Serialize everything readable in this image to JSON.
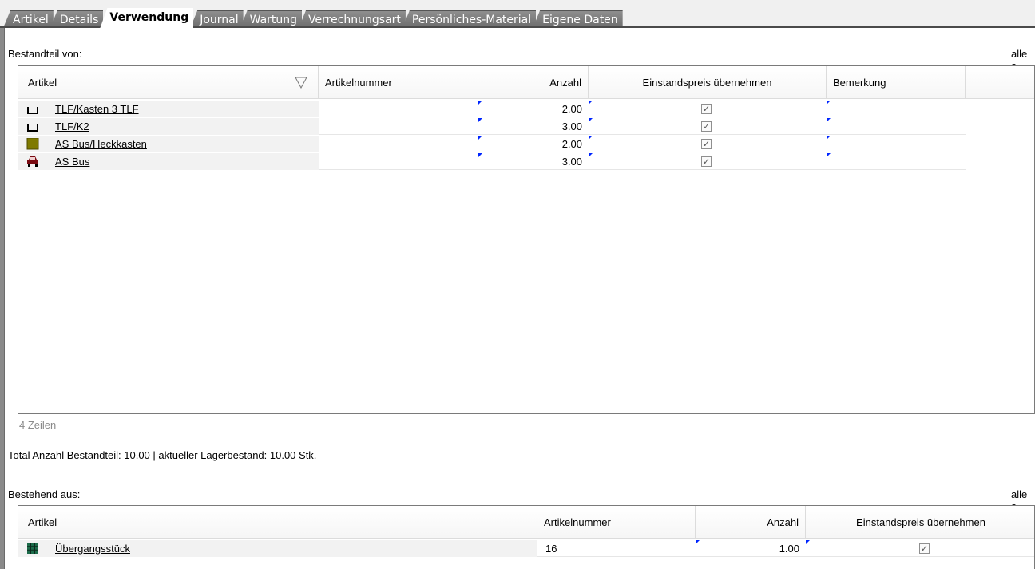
{
  "tabs": [
    {
      "label": "Artikel"
    },
    {
      "label": "Details"
    },
    {
      "label": "Verwendung",
      "active": true
    },
    {
      "label": "Journal"
    },
    {
      "label": "Wartung"
    },
    {
      "label": "Verrechnungsart"
    },
    {
      "label": "Persönliches-Material"
    },
    {
      "label": "Eigene Daten"
    }
  ],
  "top_section": {
    "label": "Bestandteil von:",
    "right_label": "alle a",
    "columns": [
      "Artikel",
      "Artikelnummer",
      "Anzahl",
      "Einstandspreis übernehmen",
      "Bemerkung"
    ],
    "rows": [
      {
        "icon": "bracket-icon",
        "artikel": "TLF/Kasten 3 TLF",
        "artikelnummer": "",
        "anzahl": "2.00",
        "einstandspreis": true,
        "bemerkung": ""
      },
      {
        "icon": "bracket-icon",
        "artikel": "TLF/K2",
        "artikelnummer": "",
        "anzahl": "3.00",
        "einstandspreis": true,
        "bemerkung": ""
      },
      {
        "icon": "olive-box-icon",
        "artikel": "AS Bus/Heckkasten",
        "artikelnummer": "",
        "anzahl": "2.00",
        "einstandspreis": true,
        "bemerkung": ""
      },
      {
        "icon": "car-icon",
        "artikel": "AS Bus",
        "artikelnummer": "",
        "anzahl": "3.00",
        "einstandspreis": true,
        "bemerkung": ""
      }
    ],
    "status": "4 Zeilen",
    "totals": "Total Anzahl Bestandteil: 10.00 | aktueller Lagerbestand: 10.00 Stk."
  },
  "bottom_section": {
    "label": "Bestehend aus:",
    "right_label": "alle a",
    "columns": [
      "Artikel",
      "Artikelnummer",
      "Anzahl",
      "Einstandspreis übernehmen"
    ],
    "rows": [
      {
        "icon": "grid-icon",
        "artikel": "Übergangsstück",
        "artikelnummer": "16",
        "anzahl": "1.00",
        "einstandspreis": true
      }
    ]
  },
  "colors": {
    "tab_inactive": "#7a7a7a",
    "marker_blue": "#0026ff",
    "olive": "#7f7a00",
    "grid_green": "#1c6b4a",
    "car_red": "#7a0a12"
  }
}
